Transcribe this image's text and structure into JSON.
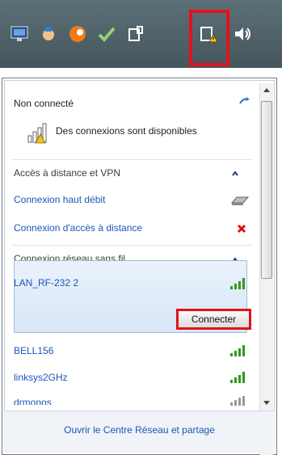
{
  "tray": {
    "icons": [
      "monitor-icon",
      "hand-icon",
      "orange-ball-icon",
      "check-icon",
      "network-plug-icon",
      "network-warning-icon",
      "speaker-icon"
    ]
  },
  "panel": {
    "status": "Non connecté",
    "available": "Des connexions sont disponibles",
    "vpn_group": "Accès à distance et VPN",
    "broadband": "Connexion haut débit",
    "dialup": "Connexion d'accès à distance",
    "wifi_group": "Connexion réseau sans fil",
    "networks": [
      {
        "name": "LAN_RF-232 2"
      },
      {
        "name": "BELL156"
      },
      {
        "name": "linksys2GHz"
      },
      {
        "name": "drmonos"
      }
    ],
    "connect_label": "Connecter",
    "footer_link": "Ouvrir le Centre Réseau et partage"
  },
  "colors": {
    "accent": "#1a56b8",
    "highlight": "#e0131b",
    "signal": "#2f9a1e"
  }
}
